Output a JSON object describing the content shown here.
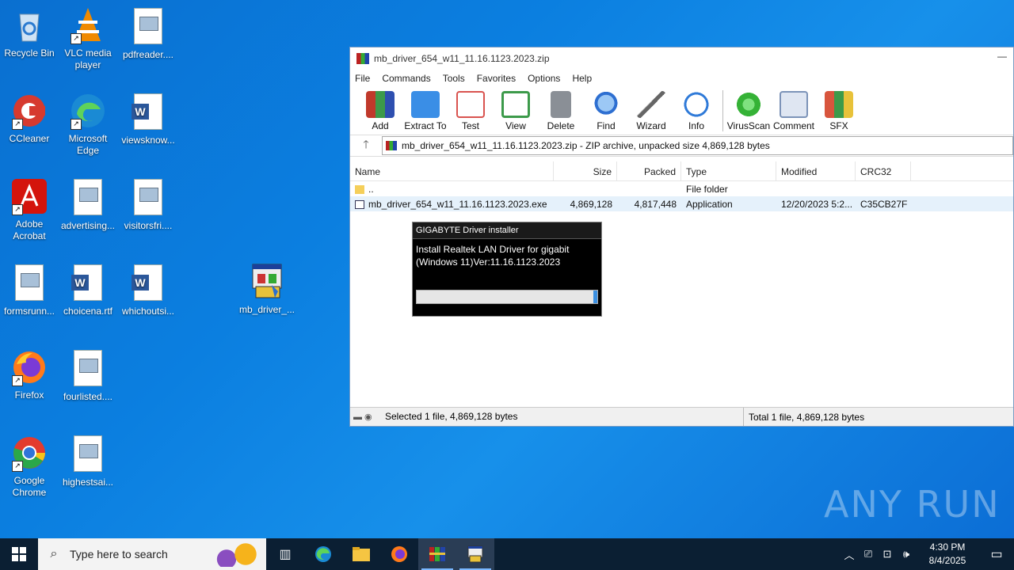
{
  "desktop": {
    "icons": [
      {
        "label": "Recycle Bin"
      },
      {
        "label": "VLC media player"
      },
      {
        "label": "pdfreader...."
      },
      {
        "label": "CCleaner"
      },
      {
        "label": "Microsoft Edge"
      },
      {
        "label": "viewsknow..."
      },
      {
        "label": "Adobe Acrobat"
      },
      {
        "label": "advertising..."
      },
      {
        "label": "visitorsfri...."
      },
      {
        "label": "formsrunn..."
      },
      {
        "label": "choicena.rtf"
      },
      {
        "label": "whichoutsi..."
      },
      {
        "label": "mb_driver_..."
      },
      {
        "label": "Firefox"
      },
      {
        "label": "fourlisted...."
      },
      {
        "label": "Google Chrome"
      },
      {
        "label": "highestsai..."
      }
    ]
  },
  "winrar": {
    "title": "mb_driver_654_w11_11.16.1123.2023.zip",
    "menu": [
      "File",
      "Commands",
      "Tools",
      "Favorites",
      "Options",
      "Help"
    ],
    "toolbar": [
      {
        "label": "Add",
        "color": "#c0392b"
      },
      {
        "label": "Extract To",
        "color": "#3a8ee6"
      },
      {
        "label": "Test",
        "color": "#d9534f"
      },
      {
        "label": "View",
        "color": "#3c9a4a"
      },
      {
        "label": "Delete",
        "color": "#8a8f96"
      },
      {
        "label": "Find",
        "color": "#2e6fd1"
      },
      {
        "label": "Wizard",
        "color": "#9ab"
      },
      {
        "label": "Info",
        "color": "#2f7ad8"
      },
      {
        "label": "VirusScan",
        "color": "#35b236"
      },
      {
        "label": "Comment",
        "color": "#7c93b8"
      },
      {
        "label": "SFX",
        "color": "#d8553d"
      }
    ],
    "address": "mb_driver_654_w11_11.16.1123.2023.zip - ZIP archive, unpacked size 4,869,128 bytes",
    "columns": {
      "name": "Name",
      "size": "Size",
      "packed": "Packed",
      "type": "Type",
      "modified": "Modified",
      "crc": "CRC32"
    },
    "rows": [
      {
        "name": "..",
        "size": "",
        "packed": "",
        "type": "File folder",
        "modified": "",
        "crc": ""
      },
      {
        "name": "mb_driver_654_w11_11.16.1123.2023.exe",
        "size": "4,869,128",
        "packed": "4,817,448",
        "type": "Application",
        "modified": "12/20/2023 5:2...",
        "crc": "C35CB27F"
      }
    ],
    "status_left": "Selected 1 file, 4,869,128 bytes",
    "status_right": "Total 1 file, 4,869,128 bytes"
  },
  "installer": {
    "title": "GIGABYTE Driver installer",
    "message": "Install Realtek LAN Driver for gigabit (Windows 11)Ver:11.16.1123.2023",
    "progress": 0.02
  },
  "taskbar": {
    "search_placeholder": "Type here to search",
    "time": "4:30 PM",
    "date": "8/4/2025"
  },
  "watermark": "ANY RUN"
}
